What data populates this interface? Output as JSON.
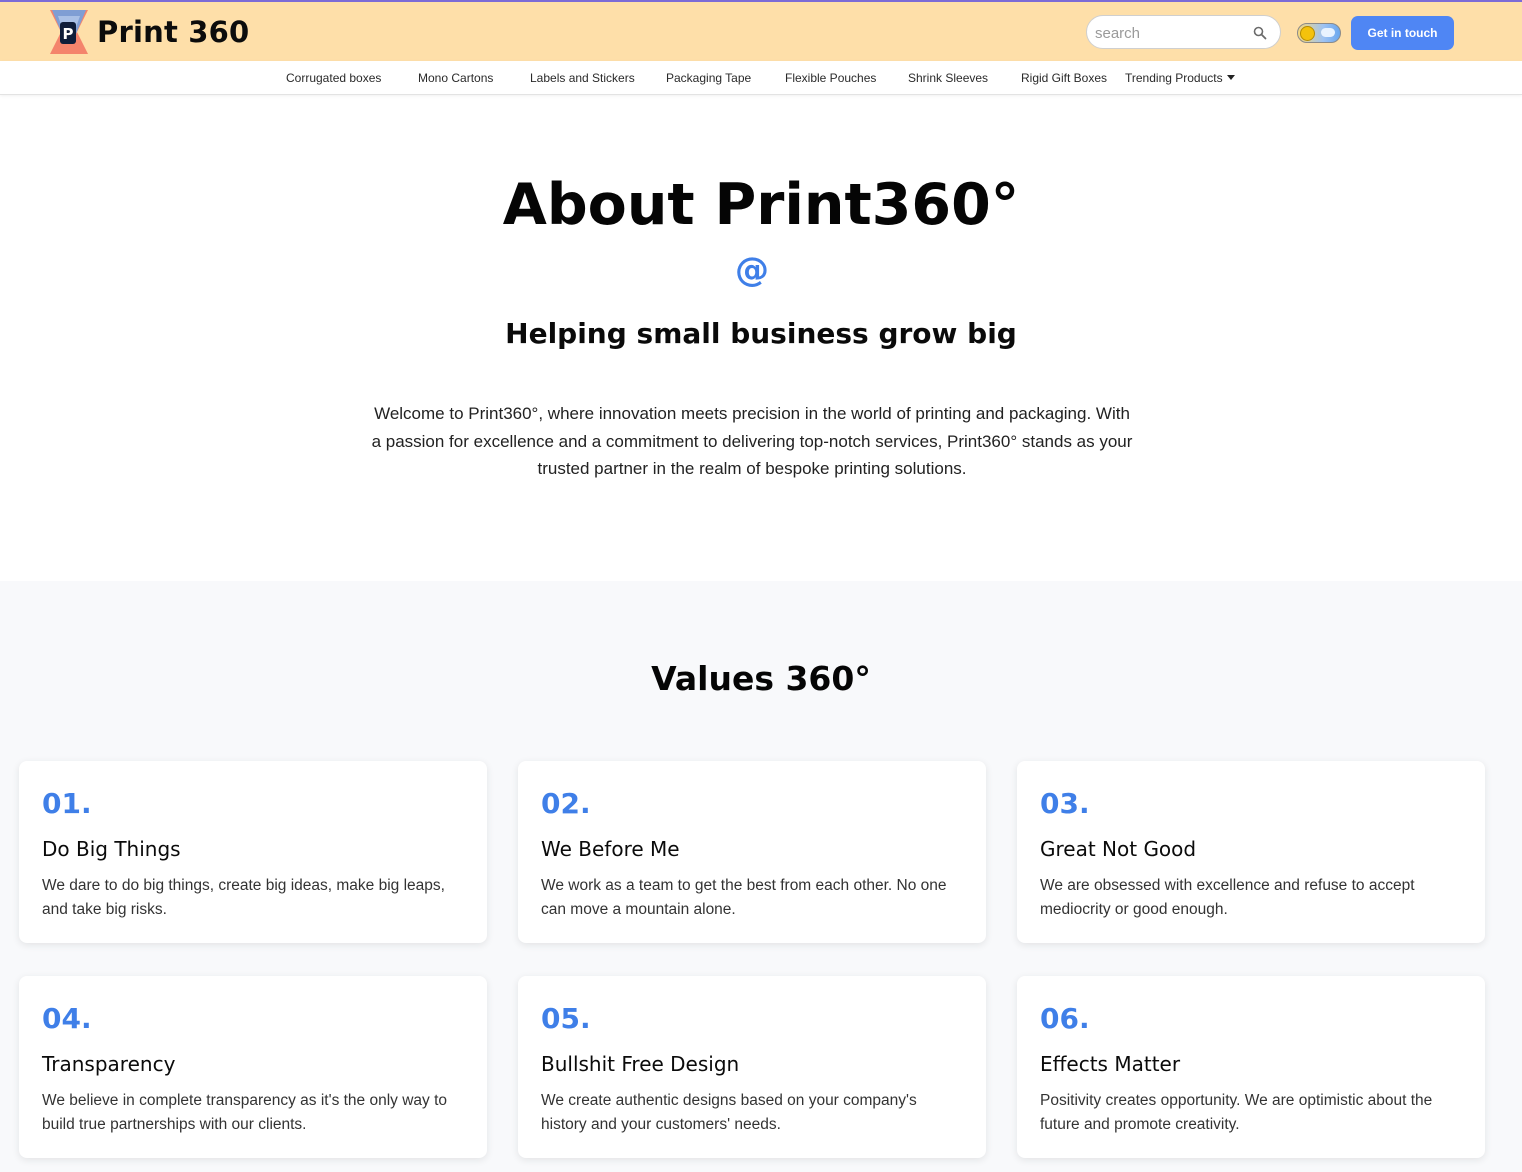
{
  "header": {
    "brand_name": "Print 360",
    "logo_letter": "P",
    "search_placeholder": "search",
    "cta_label": "Get in touch"
  },
  "nav": {
    "items": [
      "Corrugated boxes",
      "Mono Cartons",
      "Labels and Stickers",
      "Packaging Tape",
      "Flexible Pouches",
      "Shrink Sleeves",
      "Rigid Gift Boxes",
      "Trending Products"
    ]
  },
  "hero": {
    "title": "About Print360°",
    "symbol": "@",
    "subtitle": "Helping small business grow big",
    "text": "Welcome to Print360°, where innovation meets precision in the world of printing and packaging. With a passion for excellence and a commitment to delivering top-notch services, Print360° stands as your trusted partner in the realm of bespoke printing solutions."
  },
  "values": {
    "title": "Values 360°",
    "cards": [
      {
        "num": "01.",
        "title": "Do Big Things",
        "text": "We dare to do big things, create big ideas, make big leaps, and take big risks."
      },
      {
        "num": "02.",
        "title": "We Before Me",
        "text": "We work as a team to get the best from each other. No one can move a mountain alone."
      },
      {
        "num": "03.",
        "title": "Great Not Good",
        "text": "We are obsessed with excellence and refuse to accept mediocrity or good enough."
      },
      {
        "num": "04.",
        "title": "Transparency",
        "text": "We believe in complete transparency as it's the only way to build true partnerships with our clients."
      },
      {
        "num": "05.",
        "title": "Bullshit Free Design",
        "text": "We create authentic designs based on your company's history and your customers' needs."
      },
      {
        "num": "06.",
        "title": "Effects Matter",
        "text": "Positivity creates opportunity. We are optimistic about the future and promote creativity."
      }
    ]
  },
  "colors": {
    "header_bg": "#fedfa9",
    "accent": "#3f7fe8",
    "cta_bg": "#4f86f4",
    "values_bg": "#f8f9fb"
  }
}
